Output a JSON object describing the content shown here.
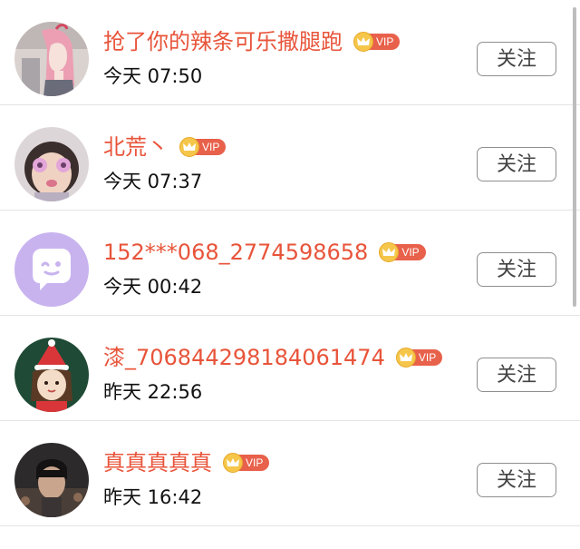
{
  "follow_label": "关注",
  "vip_label": "VIP",
  "colors": {
    "name": "#e8543a",
    "vip_badge": "#e8614b",
    "crown": "#f5c64a"
  },
  "users": [
    {
      "name": "抢了你的辣条可乐撒腿跑",
      "time": "今天 07:50",
      "avatar": "anime-girl-avatar"
    },
    {
      "name": "北荒丶",
      "time": "今天 07:37",
      "avatar": "child-photo-avatar"
    },
    {
      "name": "152***068_2774598658",
      "time": "今天 00:42",
      "avatar": "default-chat-bubble-avatar"
    },
    {
      "name": "漆_706844298184061474",
      "time": "昨天 22:56",
      "avatar": "christmas-girl-avatar"
    },
    {
      "name": "真真真真真",
      "time": "昨天 16:42",
      "avatar": "boy-photo-avatar"
    }
  ]
}
